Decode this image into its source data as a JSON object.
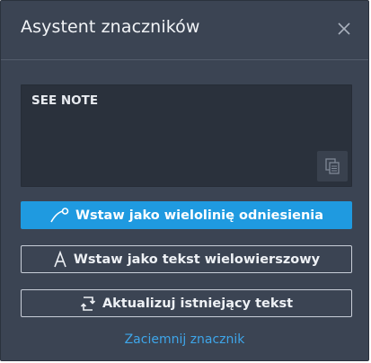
{
  "dialog": {
    "title": "Asystent znaczników"
  },
  "textbox": {
    "value": "SEE NOTE"
  },
  "buttons": {
    "insert_leader": "Wstaw jako wielolinię odniesienia",
    "insert_mtext": "Wstaw jako tekst wielowierszowy",
    "update_text": "Aktualizuj istniejący tekst"
  },
  "link": {
    "dim_markup": "Zaciemnij znacznik"
  },
  "icons": {
    "close": "close-icon",
    "copy": "copy-icon",
    "leader": "multileader-icon",
    "mtext": "text-a-icon",
    "update": "update-cycle-icon"
  },
  "colors": {
    "background": "#3b4453",
    "primary": "#1f9ae0",
    "link": "#3ea6ea"
  }
}
